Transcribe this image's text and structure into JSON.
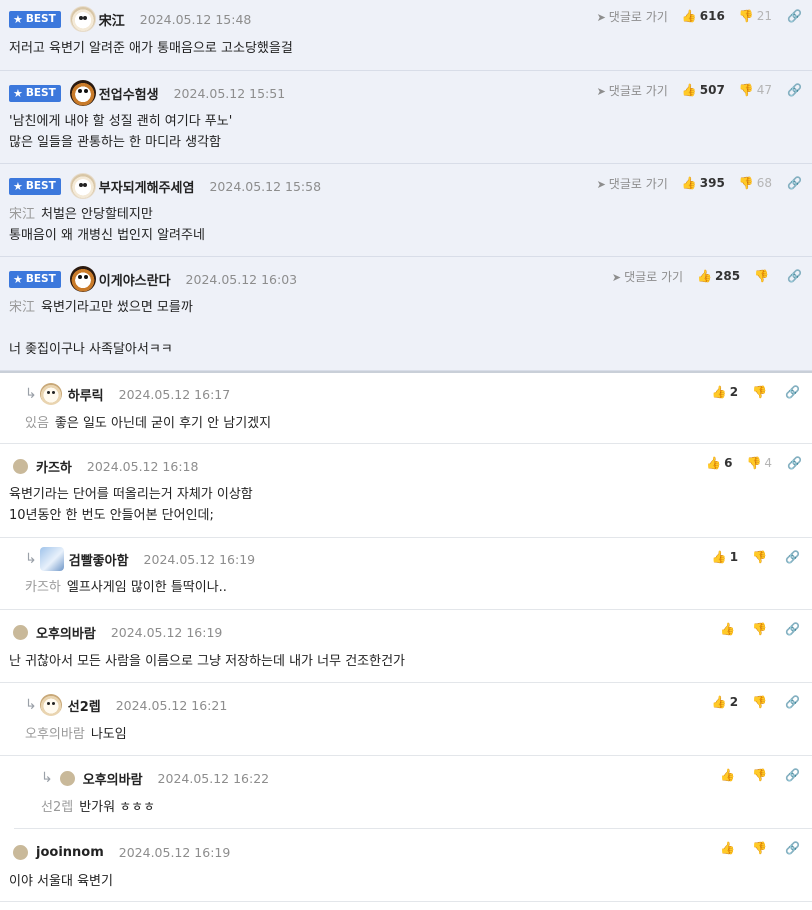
{
  "labels": {
    "best": "BEST",
    "goto": "댓글로 가기"
  },
  "comments": [
    {
      "nick": "宋江",
      "date": "2024.05.12 15:48",
      "up": "616",
      "down": "21",
      "lines": [
        "저러고 육변기 알려준 애가 통매음으로 고소당했을걸"
      ]
    },
    {
      "nick": "전업수험생",
      "date": "2024.05.12 15:51",
      "up": "507",
      "down": "47",
      "lines": [
        "'남친에게 내야 할 성질 괜히 여기다 푸노'",
        "많은 일들을 관통하는 한 마디라 생각함"
      ]
    },
    {
      "nick": "부자되게해주세염",
      "date": "2024.05.12 15:58",
      "up": "395",
      "down": "68",
      "mention": "宋江",
      "lines": [
        "처벌은 안당할테지만",
        "통매음이 왜 개병신 법인지 알려주네"
      ]
    },
    {
      "nick": "이게야스란다",
      "date": "2024.05.12 16:03",
      "up": "285",
      "down": "",
      "mention": "宋江",
      "lines": [
        "육변기라고만 썼으면 모를까",
        "너 좆집이구나 사족달아서ㅋㅋ"
      ]
    },
    {
      "nick": "하루릭",
      "date": "2024.05.12 16:17",
      "up": "2",
      "down": "",
      "mention": "있음",
      "lines": [
        "좋은 일도 아닌데 굳이 후기 안 남기겠지"
      ]
    },
    {
      "nick": "카즈하",
      "date": "2024.05.12 16:18",
      "up": "6",
      "down": "4",
      "lines": [
        "육변기라는 단어를 떠올리는거 자체가 이상함",
        "10년동안 한 번도 안들어본 단어인데;"
      ]
    },
    {
      "nick": "검빨좋아함",
      "date": "2024.05.12 16:19",
      "up": "1",
      "down": "",
      "mention": "카즈하",
      "lines": [
        "엘프사게임 많이한 틀딱이나.."
      ]
    },
    {
      "nick": "오후의바람",
      "date": "2024.05.12 16:19",
      "up": "",
      "down": "",
      "lines": [
        "난 귀찮아서 모든 사람을 이름으로 그냥 저장하는데 내가 너무 건조한건가"
      ]
    },
    {
      "nick": "선2렙",
      "date": "2024.05.12 16:21",
      "up": "2",
      "down": "",
      "mention": "오후의바람",
      "lines": [
        "나도임"
      ]
    },
    {
      "nick": "오후의바람",
      "date": "2024.05.12 16:22",
      "up": "",
      "down": "",
      "mention": "선2렙",
      "lines": [
        "반가워 ㅎㅎㅎ"
      ]
    },
    {
      "nick": "jooinnom",
      "date": "2024.05.12 16:19",
      "up": "",
      "down": "",
      "lines": [
        "이야 서울대 육변기"
      ]
    }
  ]
}
